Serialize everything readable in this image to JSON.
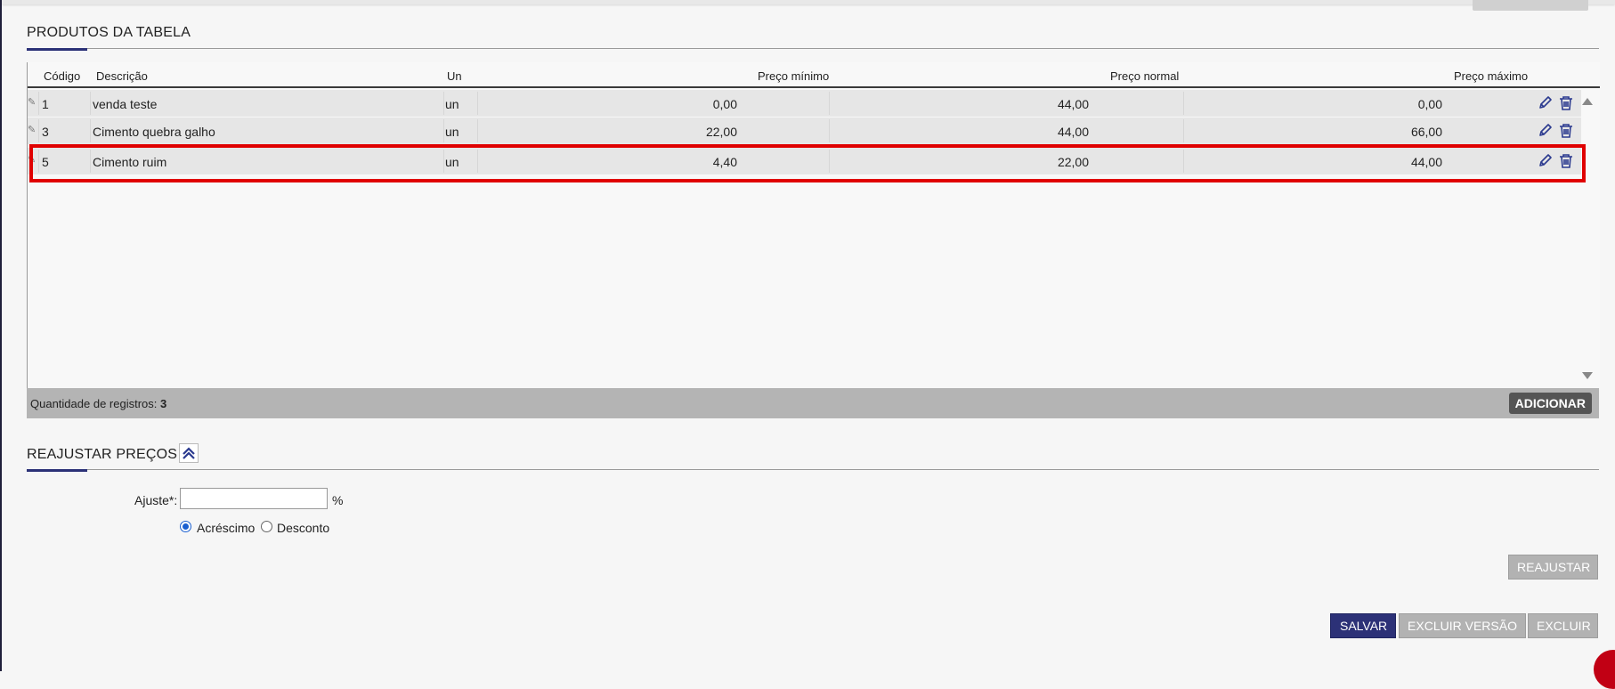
{
  "products_section": {
    "title": "PRODUTOS DA TABELA"
  },
  "grid": {
    "columns": [
      "Código",
      "Descrição",
      "Un",
      "Preço mínimo",
      "Preço normal",
      "Preço máximo"
    ],
    "rows": [
      {
        "codigo": "1",
        "descricao": "venda teste",
        "un": "un",
        "preco_minimo": "0,00",
        "preco_normal": "44,00",
        "preco_maximo": "0,00"
      },
      {
        "codigo": "3",
        "descricao": "Cimento quebra galho",
        "un": "un",
        "preco_minimo": "22,00",
        "preco_normal": "44,00",
        "preco_maximo": "66,00"
      },
      {
        "codigo": "5",
        "descricao": "Cimento ruim",
        "un": "un",
        "preco_minimo": "4,40",
        "preco_normal": "22,00",
        "preco_maximo": "44,00"
      }
    ],
    "highlighted_row": "5"
  },
  "footer": {
    "count_label": "Quantidade de registros:",
    "count_value": "3",
    "add_button": "ADICIONAR"
  },
  "reajuste": {
    "title": "REAJUSTAR PREÇOS",
    "ajuste_label": "Ajuste*:",
    "ajuste_value": "",
    "percent": "%",
    "options": [
      "Acréscimo",
      "Desconto"
    ],
    "selected_option": "Acréscimo",
    "reajustar_button": "REAJUSTAR"
  },
  "actions": {
    "save": "SALVAR",
    "delete_version": "EXCLUIR VERSÃO",
    "delete": "EXCLUIR"
  },
  "colors": {
    "primary": "#2c3177",
    "highlight": "#e00000",
    "icon": "#2b3a8f"
  }
}
